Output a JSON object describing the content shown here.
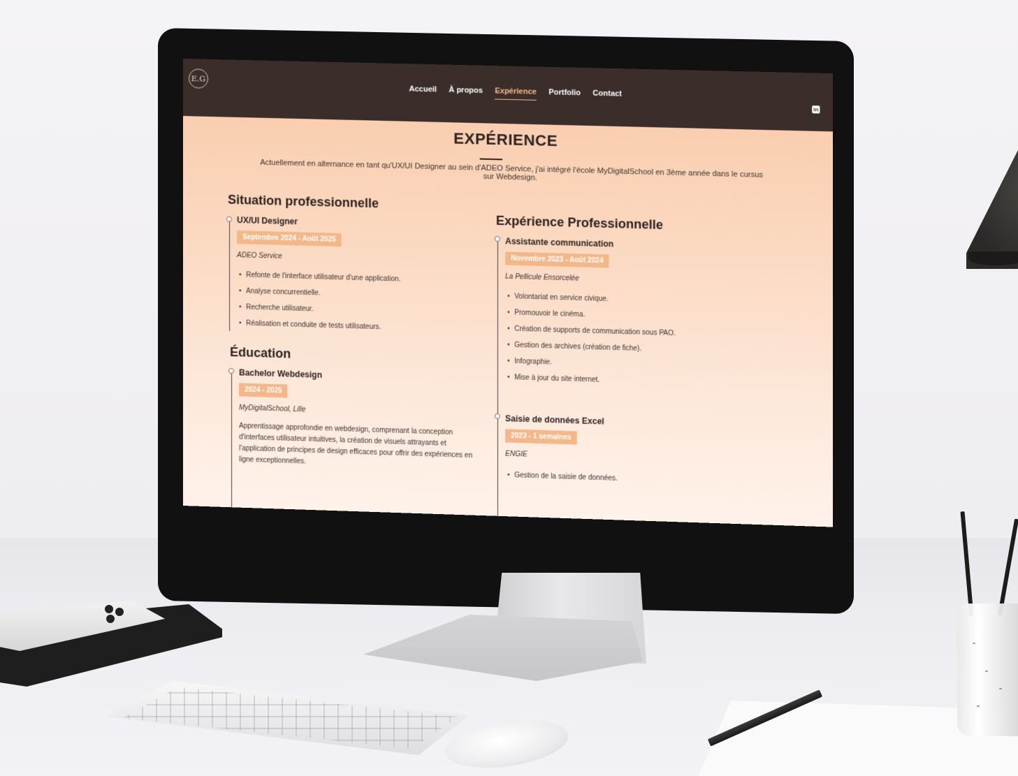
{
  "nav": {
    "logo": "E.G",
    "links": [
      "Accueil",
      "À propos",
      "Expérience",
      "Portfolio",
      "Contact"
    ],
    "active": "Expérience",
    "social_icon": "linkedin-icon",
    "social_label": "in"
  },
  "page": {
    "title": "EXPÉRIENCE",
    "intro": "Actuellement en alternance en tant qu'UX/UI Designer au sein d'ADEO Service, j'ai intégré l'école MyDigitalSchool en 3ème année dans le cursus sur Webdesign."
  },
  "situation": {
    "heading": "Situation professionnelle",
    "job_title": "UX/UI Designer",
    "dates": "Septembre 2024 - Août 2025",
    "company": "ADEO Service",
    "bullets": [
      "Refonte de l'interface utilisateur d'une application.",
      "Analyse concurrentielle.",
      "Recherche utilisateur.",
      "Réalisation et conduite de tests utilisateurs."
    ]
  },
  "education": {
    "heading": "Éducation",
    "title": "Bachelor Webdesign",
    "dates": "2024 - 2025",
    "school": "MyDigitalSchool, Lille",
    "description": "Apprentissage approfondie en webdesign, comprenant la conception d'interfaces utilisateur intuitives, la création de visuels attrayants et l'application de principes de design efficaces pour offrir des expériences en ligne exceptionnelles."
  },
  "experience": {
    "heading": "Expérience Professionnelle",
    "jobs": [
      {
        "title": "Assistante communication",
        "dates": "Novembre 2023 - Août 2024",
        "company": "La Pellicule Ensorcelée",
        "bullets": [
          "Volontariat en service civique.",
          "Promouvoir le cinéma.",
          "Création de supports de communication sous PAO.",
          "Gestion des archives (création de fiche).",
          "Infographie.",
          "Mise à jour du site internet."
        ]
      },
      {
        "title": "Saisie de données Excel",
        "dates": "2023 - 1 semaines",
        "company": "ENGIE",
        "bullets": [
          "Gestion de la saisie de données."
        ]
      }
    ]
  },
  "colors": {
    "navbar": "#3a2d2a",
    "accent": "#f4b789",
    "active_link": "#f2b88f",
    "page_gradient_top": "#f9c9a8"
  }
}
